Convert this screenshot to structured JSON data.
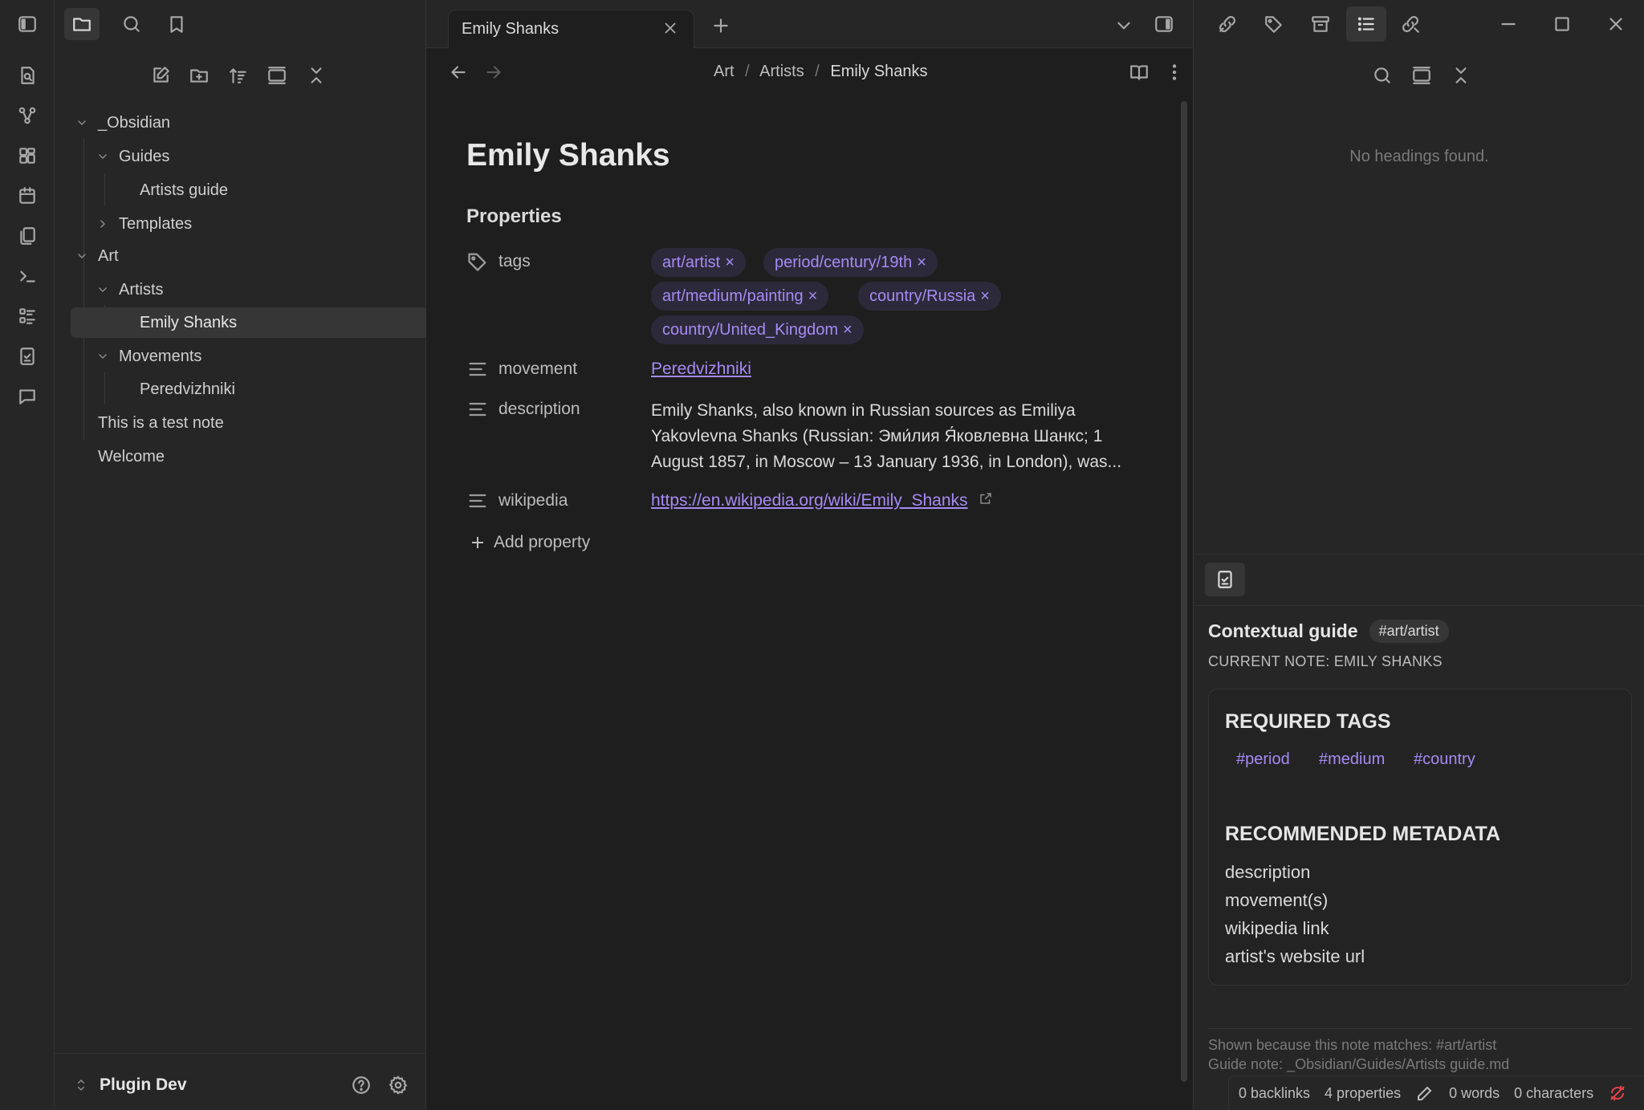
{
  "window": {
    "tab_title": "Emily Shanks"
  },
  "breadcrumb": {
    "part1": "Art",
    "sep": "/",
    "part2": "Artists",
    "part3": "Emily Shanks"
  },
  "file_tree": {
    "items": [
      {
        "label": "_Obsidian"
      },
      {
        "label": "Guides"
      },
      {
        "label": "Artists guide"
      },
      {
        "label": "Templates"
      },
      {
        "label": "Art"
      },
      {
        "label": "Artists"
      },
      {
        "label": "Emily Shanks"
      },
      {
        "label": "Movements"
      },
      {
        "label": "Peredvizhniki"
      },
      {
        "label": "This is a test note"
      },
      {
        "label": "Welcome"
      }
    ],
    "vault_name": "Plugin Dev"
  },
  "note": {
    "title": "Emily Shanks",
    "properties_heading": "Properties",
    "props": {
      "tags_label": "tags",
      "tags": [
        "art/artist",
        "period/century/19th",
        "art/medium/painting",
        "country/Russia",
        "country/United_Kingdom"
      ],
      "tag_remove": "×",
      "movement_label": "movement",
      "movement_value": "Peredvizhniki",
      "description_label": "description",
      "description_line1": "Emily Shanks, also known in Russian sources as Emiliya",
      "description_line2": "Yakovlevna Shanks (Russian: Эми́лия Я́ковлевна Шанкс; 1",
      "description_line3": "August 1857, in Moscow – 13 January 1936, in London), was...",
      "wikipedia_label": "wikipedia",
      "wikipedia_value": "https://en.wikipedia.org/wiki/Emily_Shanks"
    },
    "add_property": "Add property"
  },
  "outline": {
    "empty_text": "No headings found."
  },
  "guide": {
    "title": "Contextual guide",
    "tag": "#art/artist",
    "current_note": "CURRENT NOTE: EMILY SHANKS",
    "required_heading": "REQUIRED TAGS",
    "required_tags": [
      "#period",
      "#medium",
      "#country"
    ],
    "recommended_heading": "RECOMMENDED METADATA",
    "recommended": [
      "description",
      "movement(s)",
      "wikipedia link",
      "artist's website url"
    ],
    "footer_line1": "Shown because this note matches: #art/artist",
    "footer_line2": "Guide note: _Obsidian/Guides/Artists guide.md"
  },
  "status_bar": {
    "backlinks": "0 backlinks",
    "properties": "4 properties",
    "words": "0 words",
    "characters": "0 characters"
  },
  "colors": {
    "accent": "#a58bf5",
    "background": "#1e1e1e",
    "sidebar": "#262626"
  }
}
